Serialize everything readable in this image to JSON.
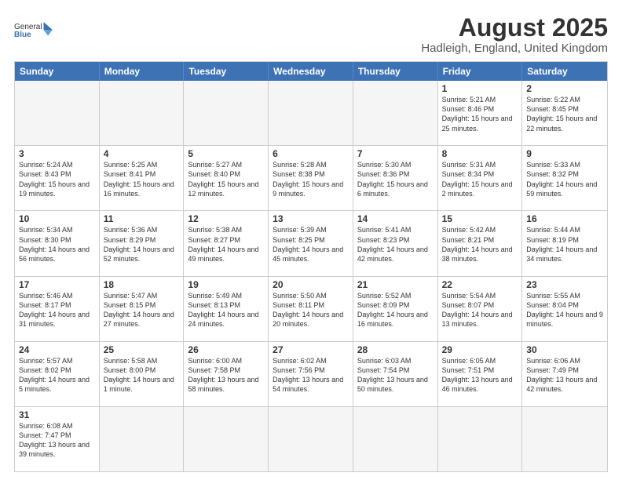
{
  "logo": {
    "text_general": "General",
    "text_blue": "Blue"
  },
  "title": "August 2025",
  "subtitle": "Hadleigh, England, United Kingdom",
  "day_headers": [
    "Sunday",
    "Monday",
    "Tuesday",
    "Wednesday",
    "Thursday",
    "Friday",
    "Saturday"
  ],
  "weeks": [
    [
      {
        "day": "",
        "info": "",
        "empty": true
      },
      {
        "day": "",
        "info": "",
        "empty": true
      },
      {
        "day": "",
        "info": "",
        "empty": true
      },
      {
        "day": "",
        "info": "",
        "empty": true
      },
      {
        "day": "",
        "info": "",
        "empty": true
      },
      {
        "day": "1",
        "info": "Sunrise: 5:21 AM\nSunset: 8:46 PM\nDaylight: 15 hours and 25 minutes.",
        "empty": false
      },
      {
        "day": "2",
        "info": "Sunrise: 5:22 AM\nSunset: 8:45 PM\nDaylight: 15 hours and 22 minutes.",
        "empty": false
      }
    ],
    [
      {
        "day": "3",
        "info": "Sunrise: 5:24 AM\nSunset: 8:43 PM\nDaylight: 15 hours and 19 minutes.",
        "empty": false
      },
      {
        "day": "4",
        "info": "Sunrise: 5:25 AM\nSunset: 8:41 PM\nDaylight: 15 hours and 16 minutes.",
        "empty": false
      },
      {
        "day": "5",
        "info": "Sunrise: 5:27 AM\nSunset: 8:40 PM\nDaylight: 15 hours and 12 minutes.",
        "empty": false
      },
      {
        "day": "6",
        "info": "Sunrise: 5:28 AM\nSunset: 8:38 PM\nDaylight: 15 hours and 9 minutes.",
        "empty": false
      },
      {
        "day": "7",
        "info": "Sunrise: 5:30 AM\nSunset: 8:36 PM\nDaylight: 15 hours and 6 minutes.",
        "empty": false
      },
      {
        "day": "8",
        "info": "Sunrise: 5:31 AM\nSunset: 8:34 PM\nDaylight: 15 hours and 2 minutes.",
        "empty": false
      },
      {
        "day": "9",
        "info": "Sunrise: 5:33 AM\nSunset: 8:32 PM\nDaylight: 14 hours and 59 minutes.",
        "empty": false
      }
    ],
    [
      {
        "day": "10",
        "info": "Sunrise: 5:34 AM\nSunset: 8:30 PM\nDaylight: 14 hours and 56 minutes.",
        "empty": false
      },
      {
        "day": "11",
        "info": "Sunrise: 5:36 AM\nSunset: 8:29 PM\nDaylight: 14 hours and 52 minutes.",
        "empty": false
      },
      {
        "day": "12",
        "info": "Sunrise: 5:38 AM\nSunset: 8:27 PM\nDaylight: 14 hours and 49 minutes.",
        "empty": false
      },
      {
        "day": "13",
        "info": "Sunrise: 5:39 AM\nSunset: 8:25 PM\nDaylight: 14 hours and 45 minutes.",
        "empty": false
      },
      {
        "day": "14",
        "info": "Sunrise: 5:41 AM\nSunset: 8:23 PM\nDaylight: 14 hours and 42 minutes.",
        "empty": false
      },
      {
        "day": "15",
        "info": "Sunrise: 5:42 AM\nSunset: 8:21 PM\nDaylight: 14 hours and 38 minutes.",
        "empty": false
      },
      {
        "day": "16",
        "info": "Sunrise: 5:44 AM\nSunset: 8:19 PM\nDaylight: 14 hours and 34 minutes.",
        "empty": false
      }
    ],
    [
      {
        "day": "17",
        "info": "Sunrise: 5:46 AM\nSunset: 8:17 PM\nDaylight: 14 hours and 31 minutes.",
        "empty": false
      },
      {
        "day": "18",
        "info": "Sunrise: 5:47 AM\nSunset: 8:15 PM\nDaylight: 14 hours and 27 minutes.",
        "empty": false
      },
      {
        "day": "19",
        "info": "Sunrise: 5:49 AM\nSunset: 8:13 PM\nDaylight: 14 hours and 24 minutes.",
        "empty": false
      },
      {
        "day": "20",
        "info": "Sunrise: 5:50 AM\nSunset: 8:11 PM\nDaylight: 14 hours and 20 minutes.",
        "empty": false
      },
      {
        "day": "21",
        "info": "Sunrise: 5:52 AM\nSunset: 8:09 PM\nDaylight: 14 hours and 16 minutes.",
        "empty": false
      },
      {
        "day": "22",
        "info": "Sunrise: 5:54 AM\nSunset: 8:07 PM\nDaylight: 14 hours and 13 minutes.",
        "empty": false
      },
      {
        "day": "23",
        "info": "Sunrise: 5:55 AM\nSunset: 8:04 PM\nDaylight: 14 hours and 9 minutes.",
        "empty": false
      }
    ],
    [
      {
        "day": "24",
        "info": "Sunrise: 5:57 AM\nSunset: 8:02 PM\nDaylight: 14 hours and 5 minutes.",
        "empty": false
      },
      {
        "day": "25",
        "info": "Sunrise: 5:58 AM\nSunset: 8:00 PM\nDaylight: 14 hours and 1 minute.",
        "empty": false
      },
      {
        "day": "26",
        "info": "Sunrise: 6:00 AM\nSunset: 7:58 PM\nDaylight: 13 hours and 58 minutes.",
        "empty": false
      },
      {
        "day": "27",
        "info": "Sunrise: 6:02 AM\nSunset: 7:56 PM\nDaylight: 13 hours and 54 minutes.",
        "empty": false
      },
      {
        "day": "28",
        "info": "Sunrise: 6:03 AM\nSunset: 7:54 PM\nDaylight: 13 hours and 50 minutes.",
        "empty": false
      },
      {
        "day": "29",
        "info": "Sunrise: 6:05 AM\nSunset: 7:51 PM\nDaylight: 13 hours and 46 minutes.",
        "empty": false
      },
      {
        "day": "30",
        "info": "Sunrise: 6:06 AM\nSunset: 7:49 PM\nDaylight: 13 hours and 42 minutes.",
        "empty": false
      }
    ],
    [
      {
        "day": "31",
        "info": "Sunrise: 6:08 AM\nSunset: 7:47 PM\nDaylight: 13 hours and 39 minutes.",
        "empty": false
      },
      {
        "day": "",
        "info": "",
        "empty": true
      },
      {
        "day": "",
        "info": "",
        "empty": true
      },
      {
        "day": "",
        "info": "",
        "empty": true
      },
      {
        "day": "",
        "info": "",
        "empty": true
      },
      {
        "day": "",
        "info": "",
        "empty": true
      },
      {
        "day": "",
        "info": "",
        "empty": true
      }
    ]
  ]
}
